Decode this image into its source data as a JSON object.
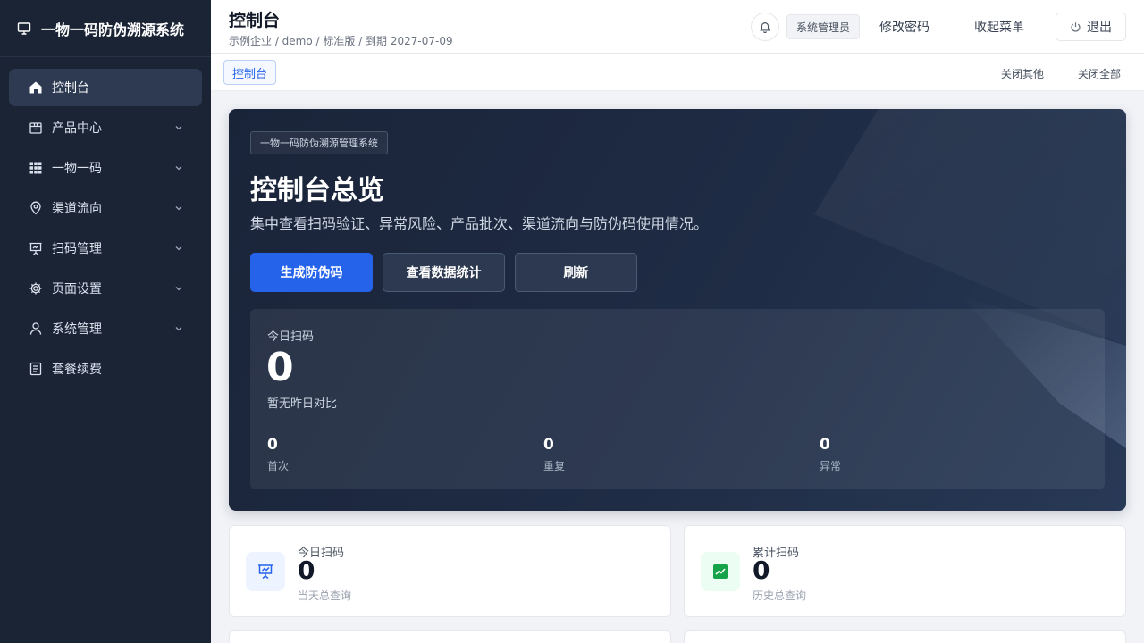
{
  "app": {
    "title": "一物一码防伪溯源系统"
  },
  "sidebar": {
    "items": [
      {
        "label": "控制台",
        "icon": "home-icon",
        "active": true
      },
      {
        "label": "产品中心",
        "icon": "package-icon"
      },
      {
        "label": "一物一码",
        "icon": "grid-icon"
      },
      {
        "label": "渠道流向",
        "icon": "map-pin-icon"
      },
      {
        "label": "扫码管理",
        "icon": "presentation-icon"
      },
      {
        "label": "页面设置",
        "icon": "gear-icon"
      },
      {
        "label": "系统管理",
        "icon": "user-icon"
      },
      {
        "label": "套餐续费",
        "icon": "document-icon"
      }
    ]
  },
  "header": {
    "title": "控制台",
    "breadcrumb": "示例企业 / demo / 标准版 / 到期 2027-07-09",
    "role": "系统管理员",
    "change_password": "修改密码",
    "collapse_menu": "收起菜单",
    "logout": "退出"
  },
  "tabs": {
    "active": "控制台",
    "close_others": "关闭其他",
    "close_all": "关闭全部"
  },
  "hero": {
    "chip": "一物一码防伪溯源管理系统",
    "title": "控制台总览",
    "subtitle": "集中查看扫码验证、异常风险、产品批次、渠道流向与防伪码使用情况。",
    "btn_generate": "生成防伪码",
    "btn_stats": "查看数据统计",
    "btn_refresh": "刷新",
    "today_label": "今日扫码",
    "today_value": "0",
    "today_note": "暂无昨日对比",
    "first_value": "0",
    "first_label": "首次",
    "repeat_value": "0",
    "repeat_label": "重复",
    "abnormal_value": "0",
    "abnormal_label": "异常"
  },
  "cards": [
    {
      "label": "今日扫码",
      "value": "0",
      "note": "当天总查询",
      "icon": "scan-screen-icon",
      "accent": "#2563eb"
    },
    {
      "label": "累计扫码",
      "value": "0",
      "note": "历史总查询",
      "icon": "trend-chart-icon",
      "accent": "#16a34a"
    }
  ],
  "colors": {
    "sidebar_bg": "#1b2435",
    "primary": "#2563eb",
    "hero_bg": "#1f2c45"
  }
}
